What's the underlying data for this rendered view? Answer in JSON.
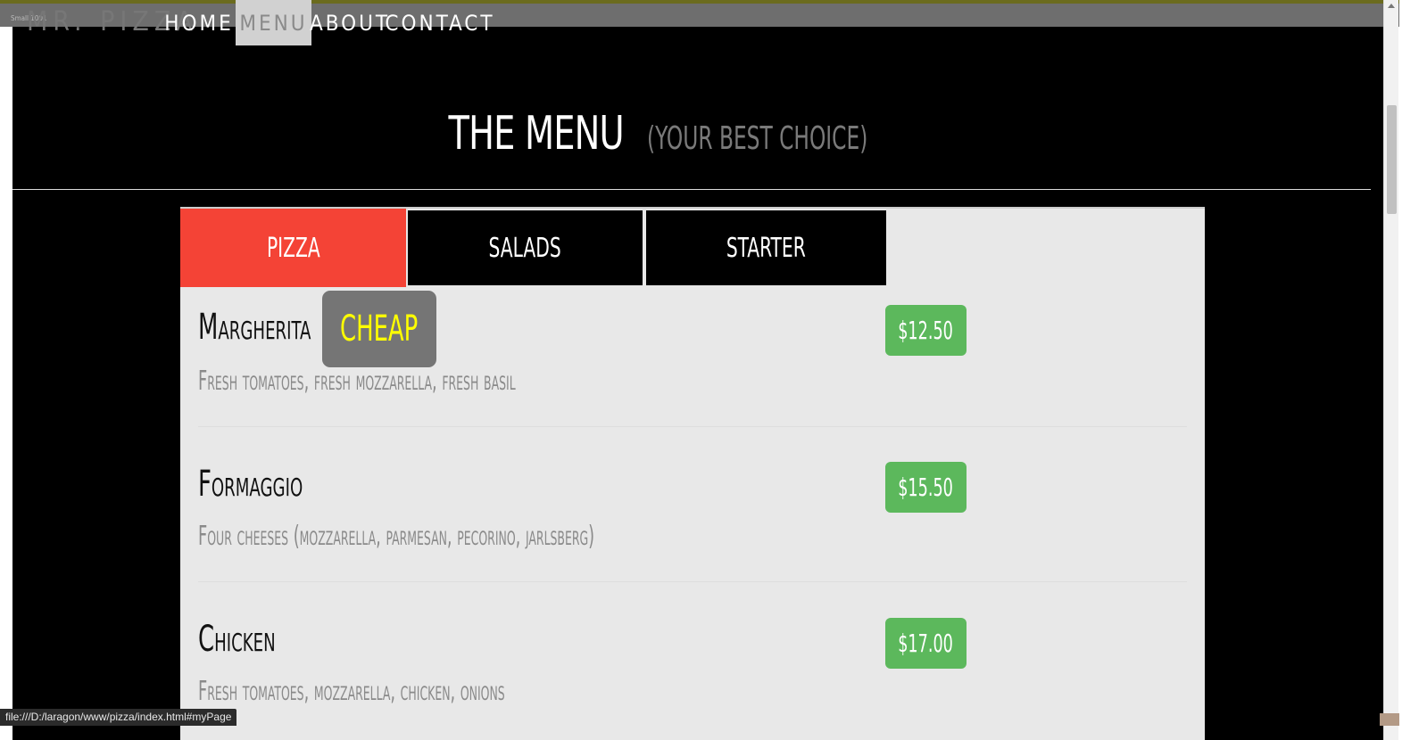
{
  "brand": {
    "logo": "MR. PIZZA",
    "small_label": "Small 1001"
  },
  "nav": [
    {
      "label": "HOME",
      "active": false
    },
    {
      "label": "MENU",
      "active": true
    },
    {
      "label": "ABOUT",
      "active": false
    },
    {
      "label": "CONTACT",
      "active": false
    }
  ],
  "heading": {
    "title": "THE MENU",
    "subtitle": "(YOUR BEST CHOICE)"
  },
  "tabs": [
    {
      "label": "PIZZA",
      "active": true
    },
    {
      "label": "SALADS",
      "active": false
    },
    {
      "label": "STARTER",
      "active": false
    }
  ],
  "items": [
    {
      "name": "Margherita",
      "badge": "CHEAP",
      "desc": "Fresh tomatoes, fresh mozzarella, fresh basil",
      "price": "$12.50"
    },
    {
      "name": "Formaggio",
      "desc": "Four cheeses (mozzarella, parmesan, pecorino, jarlsberg)",
      "price": "$15.50"
    },
    {
      "name": "Chicken",
      "desc": "Fresh tomatoes, mozzarella, chicken, onions",
      "price": "$17.00"
    }
  ],
  "statusbar": {
    "url": "file:///D:/laragon/www/pizza/index.html#myPage"
  },
  "colors": {
    "active_tab": "#f44336",
    "price": "#5cb85c",
    "badge_bg": "#757575",
    "badge_text": "#ffff00"
  }
}
